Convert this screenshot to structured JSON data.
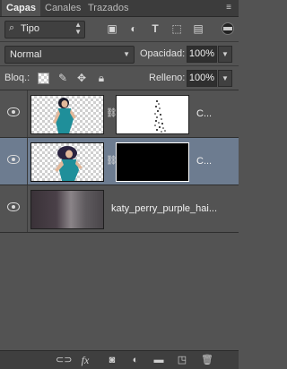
{
  "tabs": [
    {
      "label": "Capas",
      "active": true
    },
    {
      "label": "Canales",
      "active": false
    },
    {
      "label": "Trazados",
      "active": false
    }
  ],
  "filter": {
    "kind_label": "Tipo",
    "icons": [
      "image-filter-icon",
      "adjustment-filter-icon",
      "type-filter-icon",
      "shape-filter-icon",
      "smart-object-filter-icon"
    ]
  },
  "blend": {
    "mode": "Normal",
    "opacity_label": "Opacidad:",
    "opacity_value": "100%"
  },
  "lock": {
    "label": "Bloq.:",
    "fill_label": "Relleno:",
    "fill_value": "100%"
  },
  "layers": [
    {
      "name": "C...",
      "selected": false,
      "has_mask": true,
      "mask": "white-with-figure"
    },
    {
      "name": "C...",
      "selected": true,
      "has_mask": true,
      "mask": "black"
    },
    {
      "name": "katy_perry_purple_hai...",
      "selected": false,
      "has_mask": false
    }
  ],
  "bottom_icons": [
    "link-layers-icon",
    "fx-icon",
    "add-mask-icon",
    "adjustment-layer-icon",
    "group-folder-icon",
    "new-layer-icon",
    "trash-icon"
  ],
  "colors": {
    "panel_bg": "#535353",
    "selected_layer": "#6d7c90",
    "figure_teal": "#1f8f9a"
  }
}
